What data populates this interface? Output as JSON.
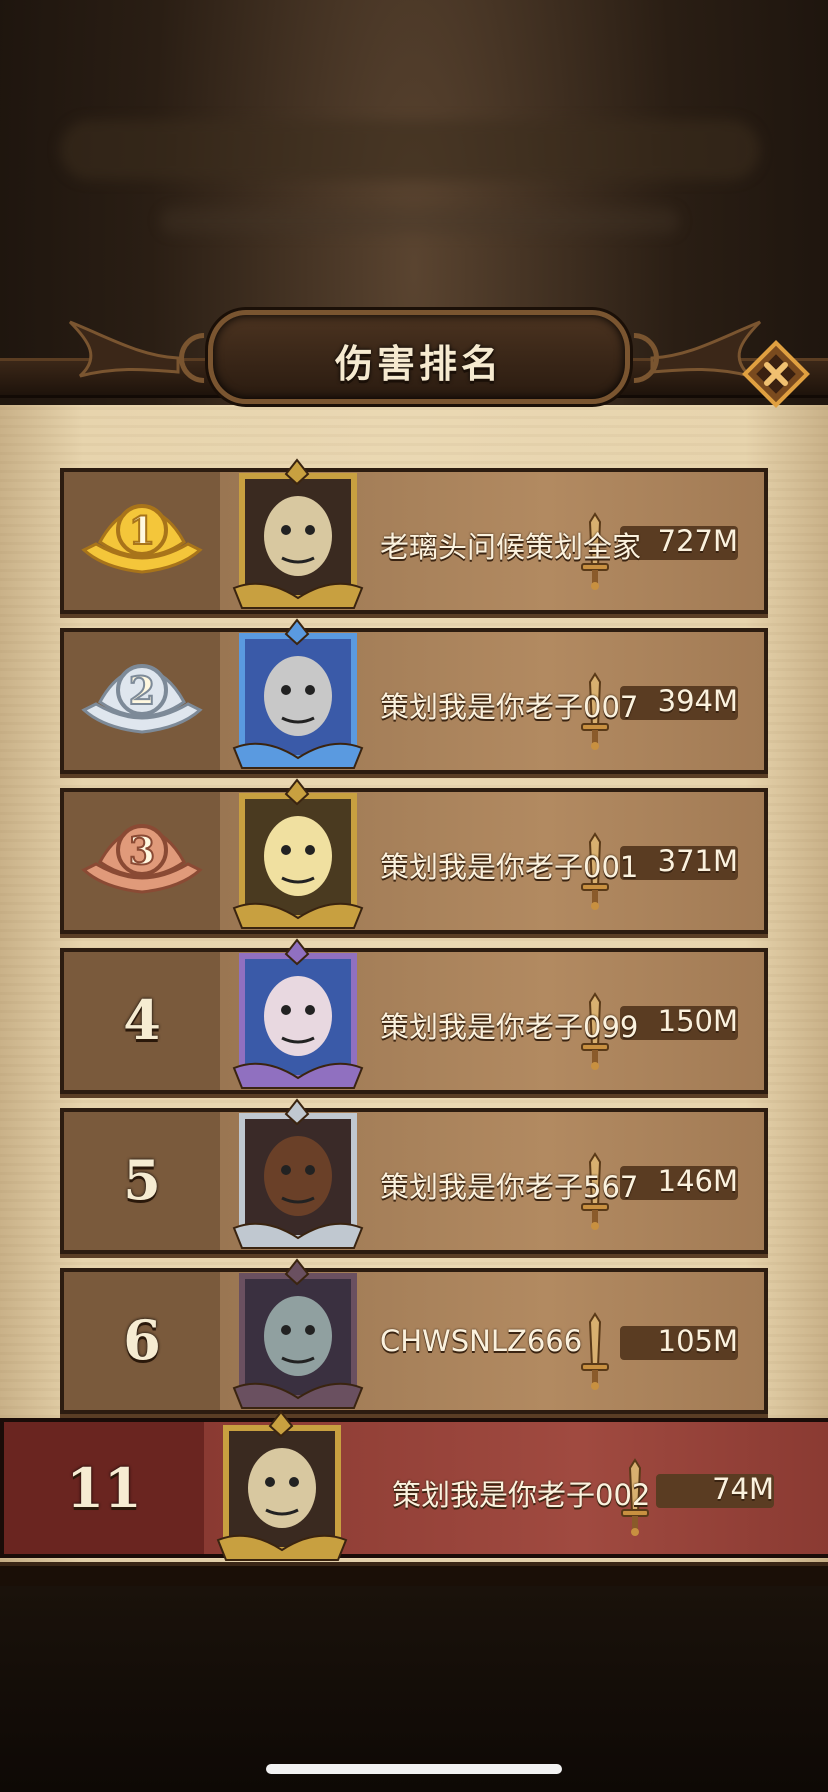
{
  "header": {
    "title": "伤害排名",
    "close_icon": "close-x-icon"
  },
  "colors": {
    "top_row_bg": "#b28a61",
    "self_row_bg": "#a04a40",
    "parchment": "#ead8b3",
    "gold_medal": "#e8b830",
    "silver_medal": "#c8d0d8",
    "bronze_medal": "#d0866a"
  },
  "rankings": [
    {
      "rank": "1",
      "badge": "gold-rank-medal",
      "avatar": "masked-scarecrow-avatar",
      "name": "老璃头问候策划全家",
      "damage": "727M"
    },
    {
      "rank": "2",
      "badge": "silver-rank-medal",
      "avatar": "robot-ghost-avatar",
      "name": "策划我是你老子007",
      "damage": "394M"
    },
    {
      "rank": "3",
      "badge": "bronze-rank-medal",
      "avatar": "blonde-knight-avatar",
      "name": "策划我是你老子001",
      "damage": "371M"
    },
    {
      "rank": "4",
      "badge": "",
      "avatar": "sleeping-girl-avatar",
      "name": "策划我是你老子099",
      "damage": "150M"
    },
    {
      "rank": "5",
      "badge": "",
      "avatar": "hat-swordsman-avatar",
      "name": "策划我是你老子567",
      "damage": "146M"
    },
    {
      "rank": "6",
      "badge": "",
      "avatar": "thorn-crown-elder-avatar",
      "name": "CHWSNLZ666",
      "damage": "105M"
    }
  ],
  "self": {
    "rank": "11",
    "avatar": "masked-scarecrow-avatar",
    "name": "策划我是你老子002",
    "damage": "74M"
  }
}
